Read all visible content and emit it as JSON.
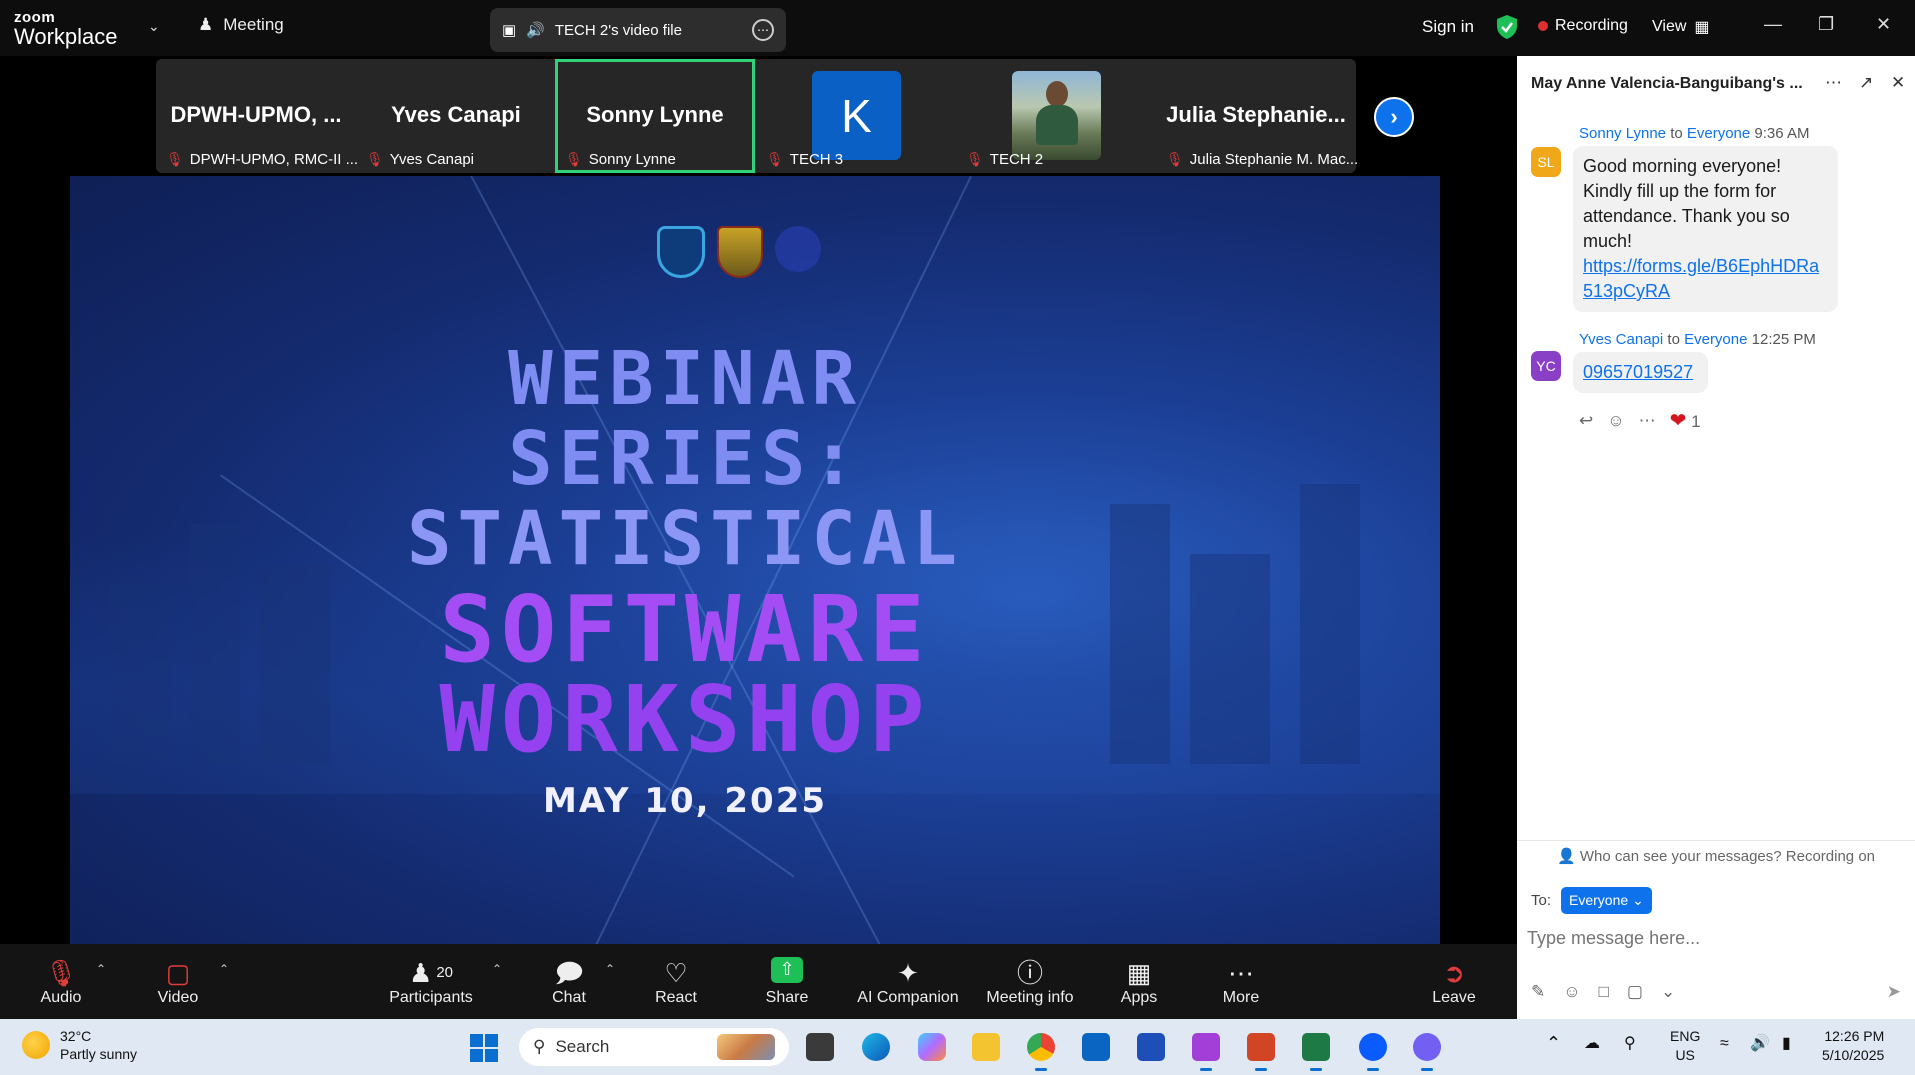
{
  "topbar": {
    "brand_top": "zoom",
    "brand_bottom": "Workplace",
    "meeting_tab": "Meeting",
    "share_title": "TECH 2's video file",
    "sign_in": "Sign in",
    "recording": "Recording",
    "view": "View"
  },
  "participants": [
    {
      "big": "DPWH-UPMO, ...",
      "label": "DPWH-UPMO, RMC-II ..."
    },
    {
      "big": "Yves Canapi",
      "label": "Yves Canapi"
    },
    {
      "big": "Sonny Lynne",
      "label": "Sonny Lynne"
    },
    {
      "avatar": "K",
      "label": "TECH 3"
    },
    {
      "label": "TECH 2"
    },
    {
      "big": "Julia  Stephanie...",
      "label": "Julia Stephanie M. Mac..."
    }
  ],
  "slide": {
    "line1": "WEBINAR",
    "line2": "SERIES:",
    "line3": "STATISTICAL",
    "line4": "SOFTWARE",
    "line5": "WORKSHOP",
    "date": "MAY 10, 2025"
  },
  "chat": {
    "header": "May Anne Valencia-Banguibang's ...",
    "messages": [
      {
        "initials": "SL",
        "sender": "Sonny Lynne",
        "to_word": "to",
        "recipient": "Everyone",
        "time": "9:36 AM",
        "text": "Good morning everyone! Kindly fill up the form for attendance. Thank you so much!",
        "link": "https://forms.gle/B6EphHDRa513pCyRA"
      },
      {
        "initials": "YC",
        "sender": "Yves Canapi",
        "to_word": "to",
        "recipient": "Everyone",
        "time": "12:25 PM",
        "link": "09657019527"
      }
    ],
    "reaction_count": "1",
    "privacy": "Who can see your messages? Recording on",
    "to_label": "To:",
    "to_value": "Everyone",
    "input_placeholder": "Type message here..."
  },
  "toolbar": {
    "audio": "Audio",
    "video": "Video",
    "participants_count": "20",
    "participants": "Participants",
    "chat": "Chat",
    "react": "React",
    "share": "Share",
    "ai": "AI Companion",
    "info": "Meeting info",
    "apps": "Apps",
    "more": "More",
    "leave": "Leave"
  },
  "taskbar": {
    "temp": "32°C",
    "condition": "Partly sunny",
    "search": "Search",
    "lang_top": "ENG",
    "lang_bottom": "US",
    "time": "12:26 PM",
    "date": "5/10/2025"
  },
  "colors": {
    "zoom_blue": "#0e72ed",
    "share_green": "#1fbf57",
    "active_speaker": "#32d27a",
    "recording_red": "#e02f2f"
  }
}
